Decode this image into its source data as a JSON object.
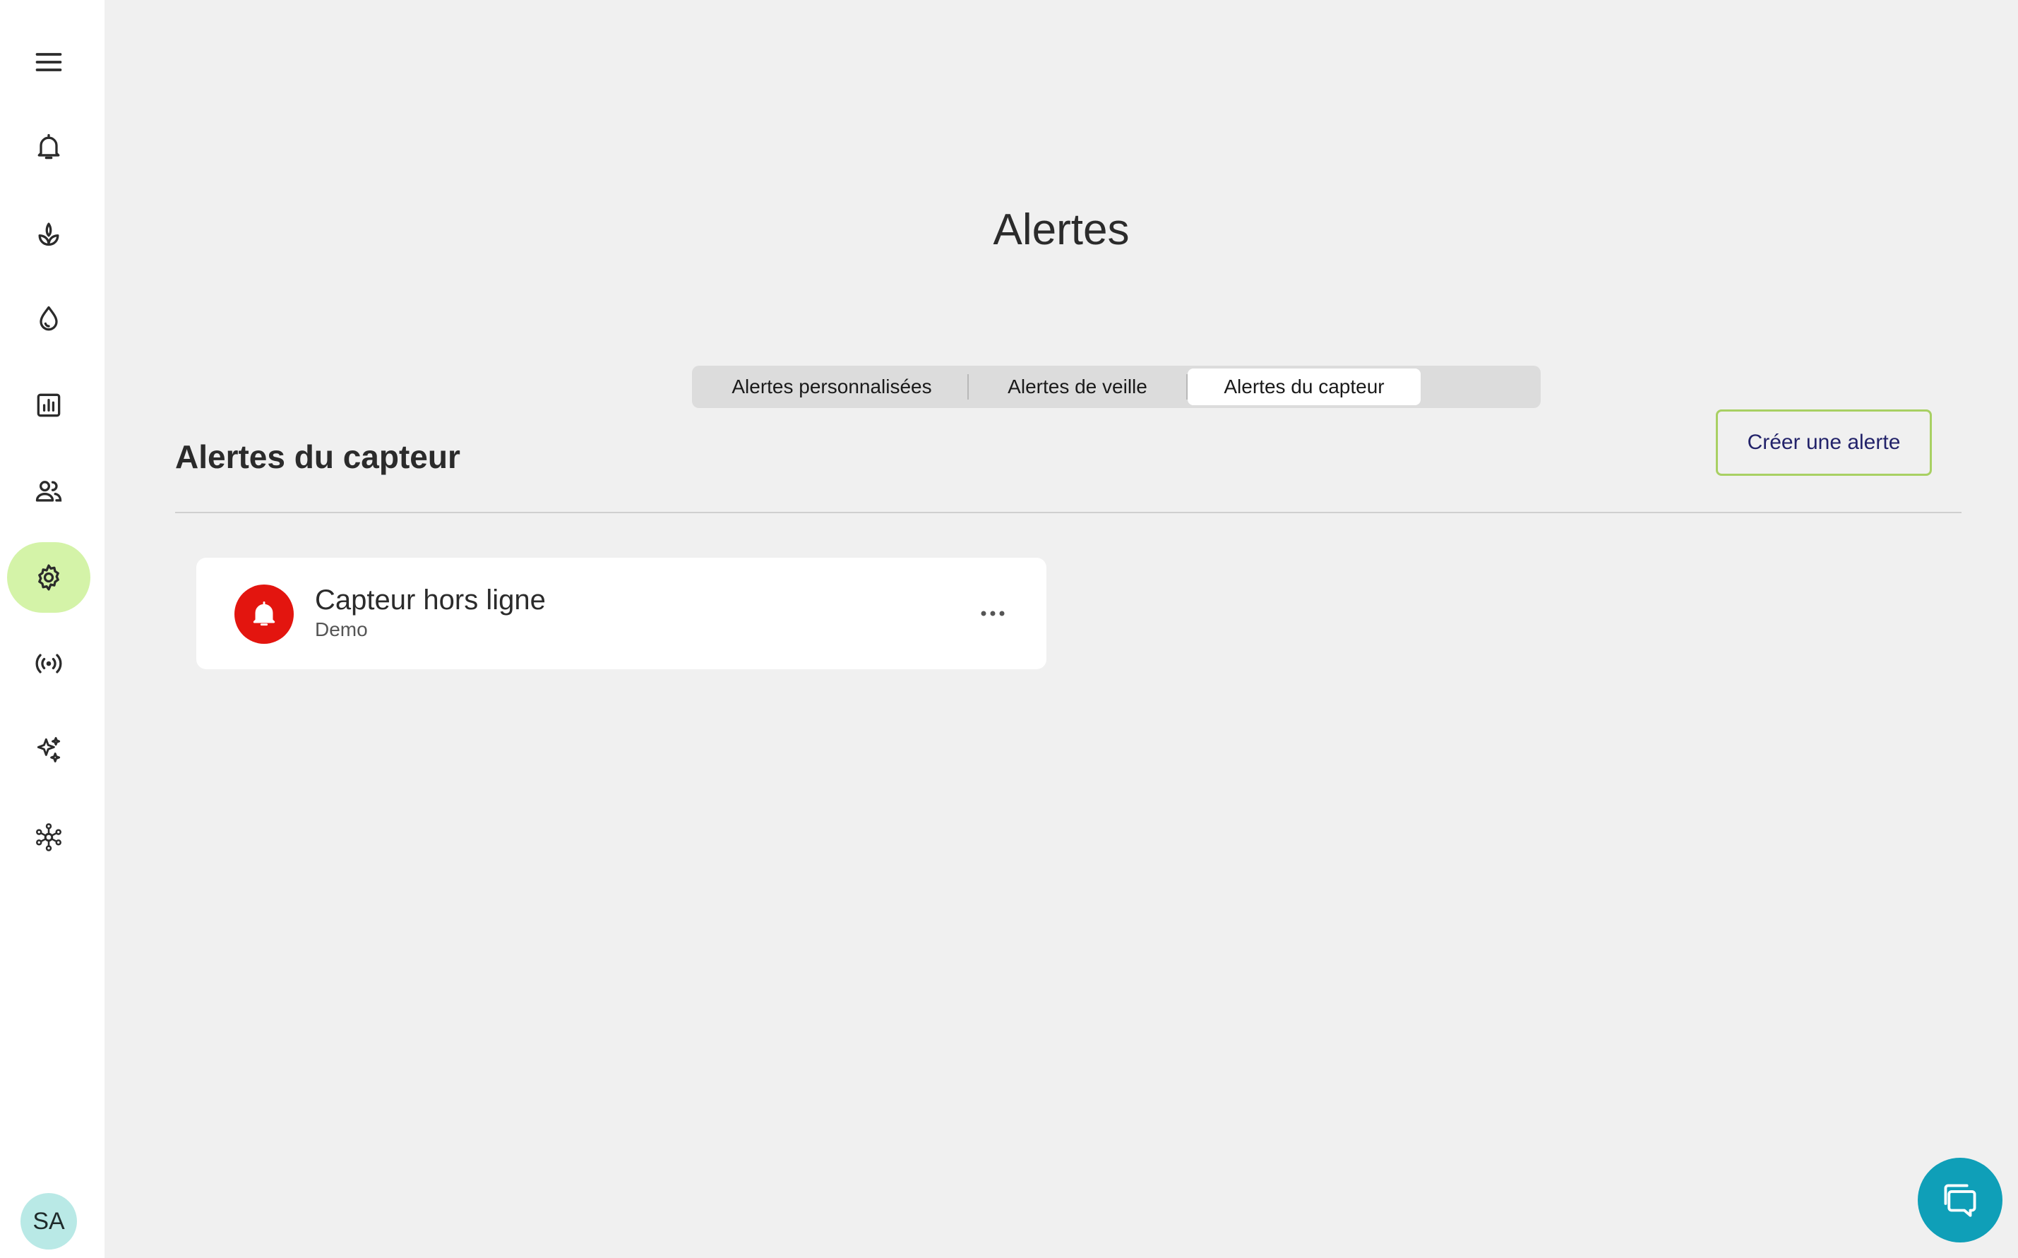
{
  "page": {
    "title": "Alertes"
  },
  "tabs": [
    {
      "label": "Alertes personnalisées",
      "selected": false
    },
    {
      "label": "Alertes de veille",
      "selected": false
    },
    {
      "label": "Alertes du capteur",
      "selected": true
    }
  ],
  "section": {
    "title": "Alertes du capteur",
    "create_label": "Créer une alerte"
  },
  "alerts": [
    {
      "name": "Capteur hors ligne",
      "subtitle": "Demo",
      "icon": "bell-icon",
      "color": "#e3150f"
    }
  ],
  "sidebar": {
    "items": [
      {
        "icon": "menu-icon"
      },
      {
        "icon": "bell-icon"
      },
      {
        "icon": "plant-icon"
      },
      {
        "icon": "water-drop-icon"
      },
      {
        "icon": "bar-chart-icon"
      },
      {
        "icon": "users-icon"
      },
      {
        "icon": "gear-icon",
        "active": true
      },
      {
        "icon": "sensor-signal-icon"
      },
      {
        "icon": "sparkles-icon"
      },
      {
        "icon": "network-icon"
      }
    ],
    "avatar_initials": "SA"
  },
  "colors": {
    "active_nav": "#d4f3a8",
    "create_border": "#a8d063",
    "chat_button": "#0f9fb8",
    "alert_icon": "#e3150f"
  }
}
